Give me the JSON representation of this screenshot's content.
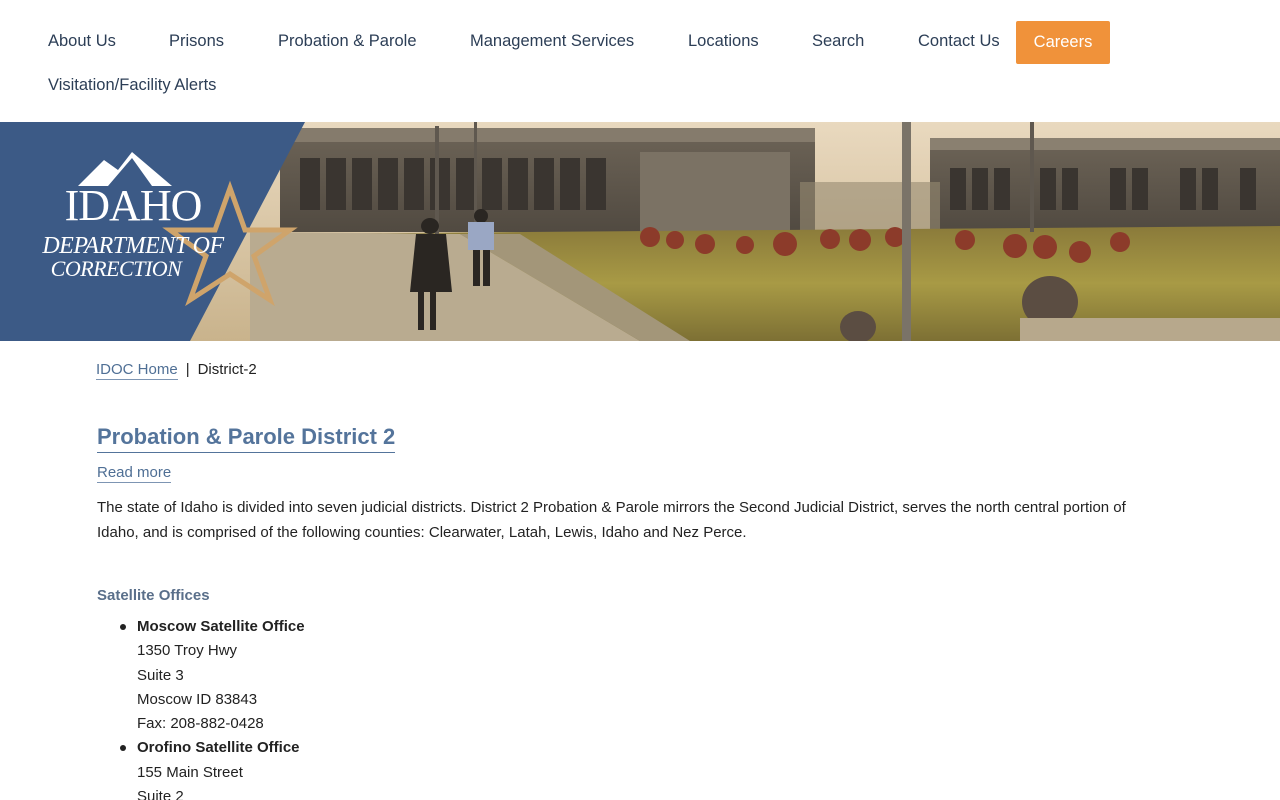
{
  "nav": {
    "items": [
      {
        "label": "About Us"
      },
      {
        "label": "Prisons"
      },
      {
        "label": "Probation & Parole"
      },
      {
        "label": "Management Services"
      },
      {
        "label": "Locations"
      },
      {
        "label": "Search"
      },
      {
        "label": "Contact Us"
      },
      {
        "label": "Visitation/Facility Alerts"
      }
    ],
    "careers": "Careers"
  },
  "logo": {
    "line1": "IDAHO",
    "line2": "DEPARTMENT OF",
    "line3": "CORRECTION"
  },
  "colors": {
    "nav_text": "#2c3e56",
    "careers_bg": "#f0923a",
    "logo_panel": "#3c5a86",
    "star_gold": "#cfa46b",
    "link": "#4f6f95",
    "heading": "#54749b"
  },
  "breadcrumb": {
    "home": "IDOC Home",
    "separator": "|",
    "current": "District-2"
  },
  "page": {
    "title": "Probation & Parole District 2",
    "read_more": "Read more",
    "intro": "The state of Idaho is divided into seven judicial districts.  District 2 Probation & Parole mirrors the Second Judicial District, serves the north central portion of Idaho, and is comprised of the following counties:  Clearwater, Latah, Lewis, Idaho and Nez Perce.",
    "satellite_heading": "Satellite Offices"
  },
  "offices": [
    {
      "name": "Moscow Satellite Office",
      "lines": [
        "1350 Troy Hwy",
        "Suite 3",
        "Moscow ID 83843",
        "Fax: 208-882-0428"
      ]
    },
    {
      "name": "Orofino Satellite Office",
      "lines": [
        "155 Main Street",
        "Suite 2"
      ]
    }
  ]
}
